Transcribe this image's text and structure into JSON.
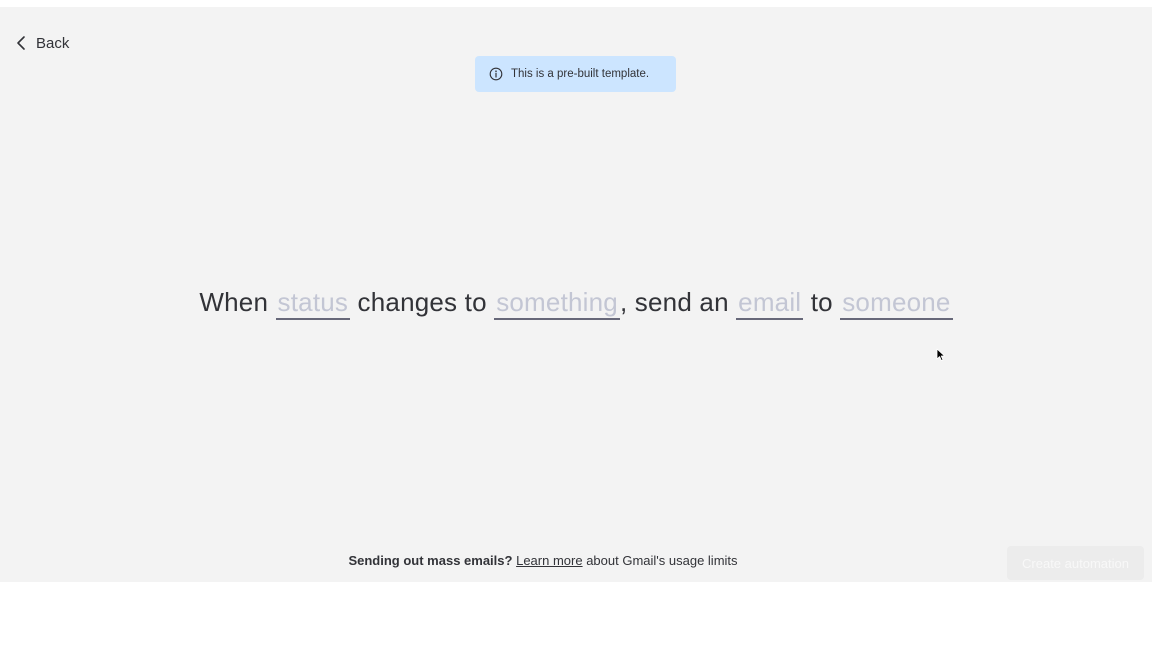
{
  "header": {
    "back_label": "Back"
  },
  "banner": {
    "icon": "info-icon",
    "text": "This is a pre-built template."
  },
  "recipe": {
    "part_1": "When ",
    "blank_1": "status",
    "part_2": " changes to ",
    "blank_2": "something",
    "part_3": ", send an ",
    "blank_3": "email",
    "part_4": " to ",
    "blank_4": "someone"
  },
  "footer": {
    "bold_text": "Sending out mass emails?",
    "link_text": "Learn more",
    "trailing_text": "about Gmail's usage limits"
  },
  "actions": {
    "create_label": "Create automation"
  },
  "colors": {
    "panel_bg": "#f3f3f3",
    "banner_bg": "#cce5ff",
    "text": "#323338",
    "placeholder": "#c3c6d4"
  }
}
